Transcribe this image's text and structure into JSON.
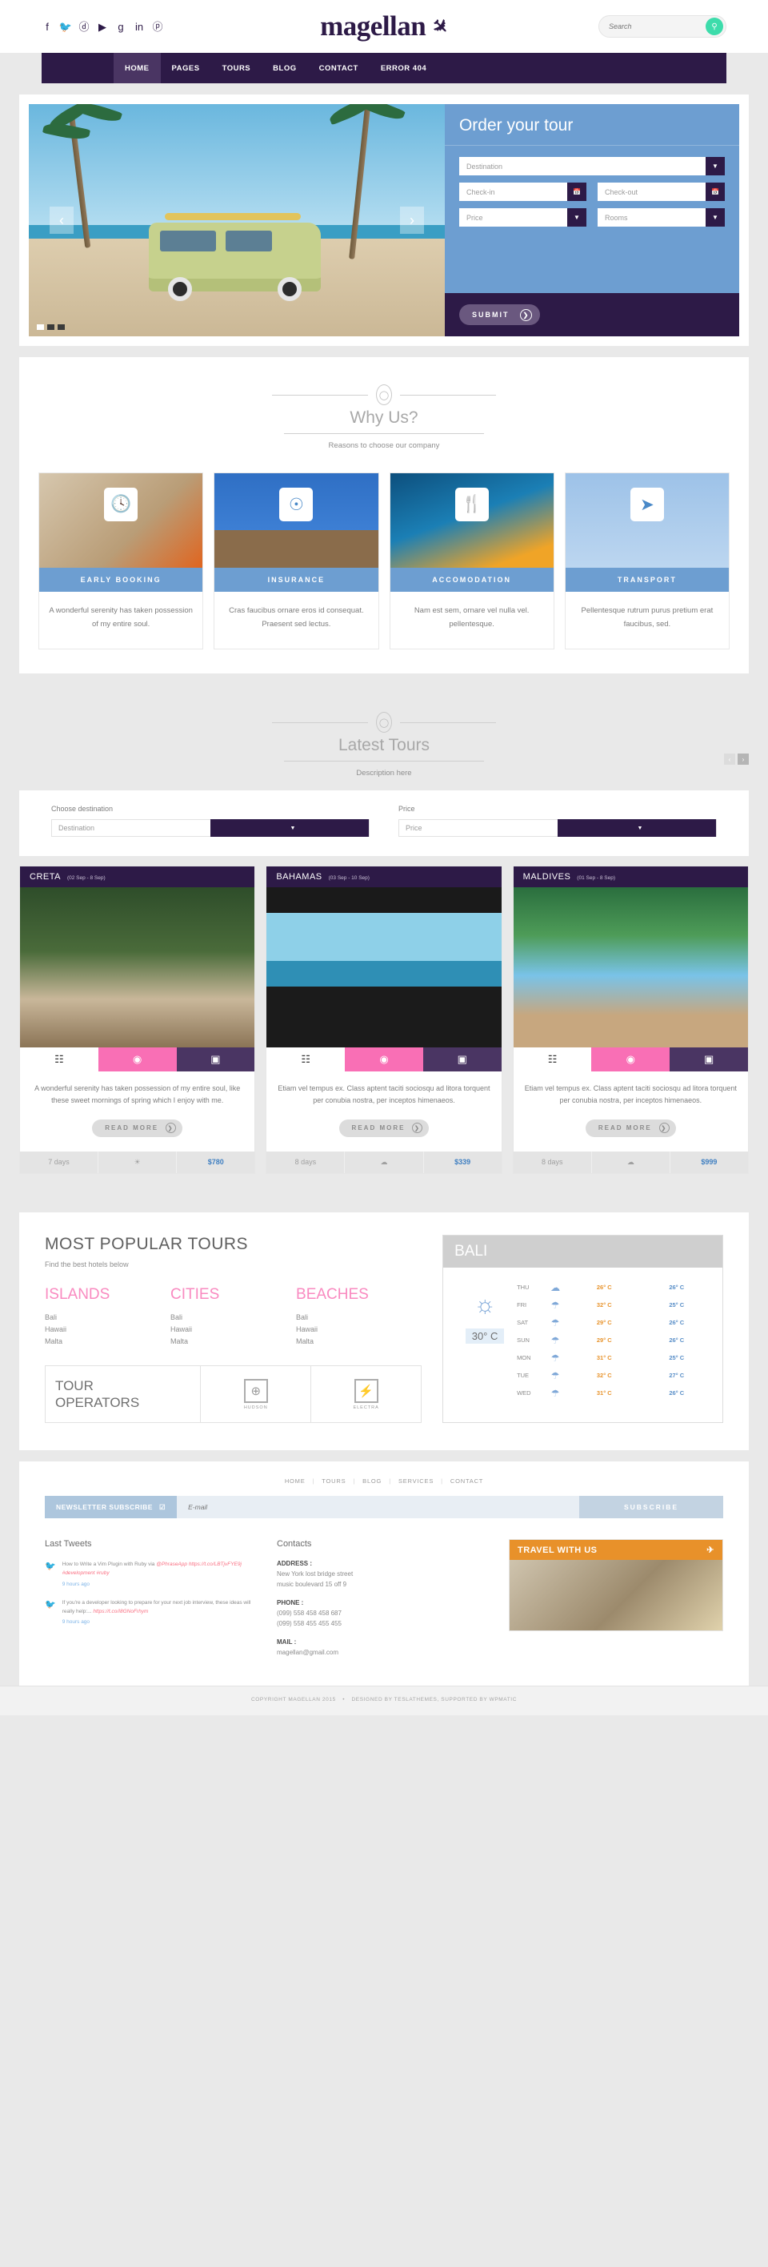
{
  "header": {
    "brand": "magellan",
    "brand_icon": "airplane-icon",
    "social": [
      {
        "name": "facebook-icon",
        "glyph": "f"
      },
      {
        "name": "twitter-icon",
        "glyph": "🐦"
      },
      {
        "name": "dribbble-icon",
        "glyph": "ⓓ"
      },
      {
        "name": "youtube-icon",
        "glyph": "▶"
      },
      {
        "name": "google-plus-icon",
        "glyph": "g"
      },
      {
        "name": "linkedin-icon",
        "glyph": "in"
      },
      {
        "name": "pinterest-icon",
        "glyph": "ⓟ"
      }
    ],
    "search": {
      "placeholder": "Search",
      "value": "",
      "button_icon": "search-icon"
    }
  },
  "nav": {
    "items": [
      {
        "label": "HOME",
        "active": true
      },
      {
        "label": "PAGES",
        "active": false
      },
      {
        "label": "TOURS",
        "active": false
      },
      {
        "label": "BLOG",
        "active": false
      },
      {
        "label": "CONTACT",
        "active": false
      },
      {
        "label": "ERROR 404",
        "active": false
      }
    ]
  },
  "hero": {
    "slider": {
      "prev_icon": "chevron-left-icon",
      "next_icon": "chevron-right-icon",
      "slides": 3,
      "active_slide": 1
    },
    "order": {
      "title": "Order your tour",
      "destination": {
        "placeholder": "Destination",
        "icon": "chevron-down-icon"
      },
      "checkin": {
        "placeholder": "Check-in",
        "icon": "calendar-icon"
      },
      "checkout": {
        "placeholder": "Check-out",
        "icon": "calendar-icon"
      },
      "price": {
        "placeholder": "Price",
        "icon": "chevron-down-icon"
      },
      "rooms": {
        "placeholder": "Rooms",
        "icon": "chevron-down-icon"
      },
      "submit_label": "SUBMIT"
    }
  },
  "why_us": {
    "title": "Why Us?",
    "subtitle": "Reasons to choose our company",
    "cards": [
      {
        "label": "EARLY BOOKING",
        "icon": "clock-icon",
        "glyph": "🕓",
        "desc": "A wonderful serenity has taken possession of my entire soul."
      },
      {
        "label": "INSURANCE",
        "icon": "lifebuoy-icon",
        "glyph": "☉",
        "desc": "Cras faucibus ornare eros id consequat. Praesent sed lectus."
      },
      {
        "label": "ACCOMODATION",
        "icon": "cutlery-icon",
        "glyph": "🍴",
        "desc": "Nam est sem, ornare vel nulla vel. pellentesque."
      },
      {
        "label": "TRANSPORT",
        "icon": "paper-plane-icon",
        "glyph": "➤",
        "desc": "Pellentesque rutrum purus pretium erat faucibus, sed."
      }
    ]
  },
  "latest_tours": {
    "title": "Latest Tours",
    "subtitle": "Description here",
    "prev_icon": "chevron-left-icon",
    "next_icon": "chevron-right-icon",
    "filters": {
      "destination_label": "Choose destination",
      "destination_value": "Destination",
      "price_label": "Price",
      "price_value": "Price"
    },
    "cards": [
      {
        "name": "CRETA",
        "dates": "(02 Sep - 8 Sep)",
        "actions": [
          "document-icon",
          "eye-icon",
          "camera-icon"
        ],
        "desc": "A wonderful serenity has taken possession of my entire soul, like these sweet mornings of spring which I enjoy with me.",
        "read_more": "READ MORE",
        "days": "7 days",
        "weather_icon": "sun-icon",
        "price": "$780"
      },
      {
        "name": "BAHAMAS",
        "dates": "(03 Sep - 10 Sep)",
        "actions": [
          "document-icon",
          "eye-icon",
          "camera-icon"
        ],
        "desc": "Etiam vel tempus ex. Class aptent taciti sociosqu ad litora torquent per conubia nostra, per inceptos himenaeos.",
        "read_more": "READ MORE",
        "days": "8 days",
        "weather_icon": "cloud-icon",
        "price": "$339"
      },
      {
        "name": "MALDIVES",
        "dates": "(01 Sep - 8 Sep)",
        "actions": [
          "document-icon",
          "eye-icon",
          "camera-icon"
        ],
        "desc": "Etiam vel tempus ex. Class aptent taciti sociosqu ad litora torquent per conubia nostra, per inceptos himenaeos.",
        "read_more": "READ MORE",
        "days": "8 days",
        "weather_icon": "cloud-icon",
        "price": "$999"
      }
    ]
  },
  "popular": {
    "title": "MOST POPULAR TOURS",
    "subtitle": "Find the best hotels below",
    "columns": [
      {
        "heading": "ISLANDS",
        "items": [
          "Bali",
          "Hawaii",
          "Malta"
        ]
      },
      {
        "heading": "CITIES",
        "items": [
          "Bali",
          "Hawaii",
          "Malta"
        ]
      },
      {
        "heading": "BEACHES",
        "items": [
          "Bali",
          "Hawaii",
          "Malta"
        ]
      }
    ],
    "operators": {
      "title_line1": "TOUR",
      "title_line2": "OPERATORS",
      "logos": [
        {
          "name": "hudson-logo",
          "label": "HUDSON",
          "glyph": "⊕"
        },
        {
          "name": "electra-logo",
          "label": "ELECTRA",
          "glyph": "⚡"
        }
      ]
    }
  },
  "weather": {
    "city": "BALI",
    "current_icon": "sun-icon",
    "current_temp": "30° C",
    "rows": [
      {
        "day": "THU",
        "icon": "cloud-icon",
        "high": "26° C",
        "low": "26° C"
      },
      {
        "day": "FRI",
        "icon": "rain-icon",
        "high": "32° C",
        "low": "25° C"
      },
      {
        "day": "SAT",
        "icon": "rain-icon",
        "high": "29° C",
        "low": "26° C"
      },
      {
        "day": "SUN",
        "icon": "rain-icon",
        "high": "29° C",
        "low": "26° C"
      },
      {
        "day": "MON",
        "icon": "rain-icon",
        "high": "31° C",
        "low": "25° C"
      },
      {
        "day": "TUE",
        "icon": "rain-icon",
        "high": "32° C",
        "low": "27° C"
      },
      {
        "day": "WED",
        "icon": "rain-icon",
        "high": "31° C",
        "low": "26° C"
      }
    ]
  },
  "footer": {
    "nav": [
      "HOME",
      "TOURS",
      "BLOG",
      "SERVICES",
      "CONTACT"
    ],
    "newsletter": {
      "label": "NEWSLETTER SUBSCRIBE",
      "label_icon": "check-square-icon",
      "placeholder": "E-mail",
      "value": "",
      "button": "SUBSCRIBE"
    },
    "tweets": {
      "title": "Last Tweets",
      "items": [
        {
          "icon": "twitter-icon",
          "text": "How to Write a Vim Plugin with Ruby via ",
          "link1": "@PhraseApp",
          "link2": "https://t.co/LBTjvFYE9j #development #ruby",
          "ago": "9 hours ago"
        },
        {
          "icon": "twitter-icon",
          "text": "If you're a developer looking to prepare for your next job interview, these ideas will really help:... ",
          "link1": "",
          "link2": "https://t.co/I8GNoFrhym",
          "ago": "9 hours ago"
        }
      ]
    },
    "contacts": {
      "title": "Contacts",
      "blocks": [
        {
          "label": "ADDRESS :",
          "value": "New York lost bridge street\nmusic boulevard 15 off 9"
        },
        {
          "label": "PHONE :",
          "value": "(099) 558 458 458 687\n(099) 558 455 455 455"
        },
        {
          "label": "MAIL :",
          "value": "magellan@gmail.com"
        }
      ]
    },
    "promo": {
      "title": "TRAVEL WITH US",
      "icon": "airplane-icon"
    },
    "copyright": "COPYRIGHT MAGELLAN 2015",
    "credits": "DESIGNED BY TESLATHEMES, SUPPORTED BY WPMATIC"
  }
}
